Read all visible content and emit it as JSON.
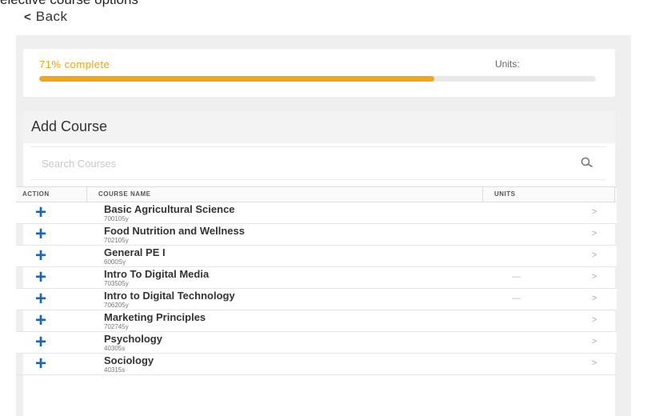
{
  "top": {
    "cut_text": "elective course options"
  },
  "nav": {
    "back_label": "Back"
  },
  "progress": {
    "label": "71% complete",
    "units_label": "Units:",
    "fraction": 0.71,
    "color": "#f2a71b"
  },
  "add_course": {
    "title": "Add Course",
    "search_placeholder": "Search Courses",
    "columns": {
      "action": "ACTION",
      "name": "COURSE NAME",
      "units": "UNITS"
    },
    "rows": [
      {
        "name": "Basic Agricultural Science",
        "code": "700105y",
        "units": ""
      },
      {
        "name": "Food Nutrition and Wellness",
        "code": "702105y",
        "units": ""
      },
      {
        "name": "General PE I",
        "code": "6000Sy",
        "units": ""
      },
      {
        "name": "Intro To Digital Media",
        "code": "703505y",
        "units": "—"
      },
      {
        "name": "Intro to Digital Technology",
        "code": "706205y",
        "units": "—"
      },
      {
        "name": "Marketing Principles",
        "code": "702745y",
        "units": ""
      },
      {
        "name": "Psychology",
        "code": "40305s",
        "units": ""
      },
      {
        "name": "Sociology",
        "code": "40315s",
        "units": ""
      }
    ]
  },
  "icons": {
    "add": "+",
    "chevron": ">",
    "back_chevron": "<"
  },
  "colors": {
    "accent": "#f0a31a",
    "add_blue": "#1565c0"
  }
}
